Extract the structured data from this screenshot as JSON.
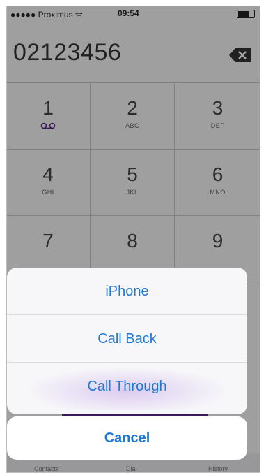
{
  "status": {
    "carrier": "●●●●● Proximus ᯤ",
    "time": "09:54"
  },
  "dialer": {
    "number": "02123456",
    "keys": [
      {
        "digit": "1",
        "letters": ""
      },
      {
        "digit": "2",
        "letters": "ABC"
      },
      {
        "digit": "3",
        "letters": "DEF"
      },
      {
        "digit": "4",
        "letters": "GHI"
      },
      {
        "digit": "5",
        "letters": "JKL"
      },
      {
        "digit": "6",
        "letters": "MNO"
      },
      {
        "digit": "7",
        "letters": ""
      },
      {
        "digit": "8",
        "letters": ""
      },
      {
        "digit": "9",
        "letters": ""
      }
    ]
  },
  "tabs": [
    "Contacts",
    "Dial",
    "History"
  ],
  "action_sheet": {
    "options": [
      "iPhone",
      "Call Back",
      "Call Through"
    ],
    "cancel": "Cancel"
  },
  "colors": {
    "accent": "#1f7ad6",
    "brand": "#5b2a86"
  }
}
